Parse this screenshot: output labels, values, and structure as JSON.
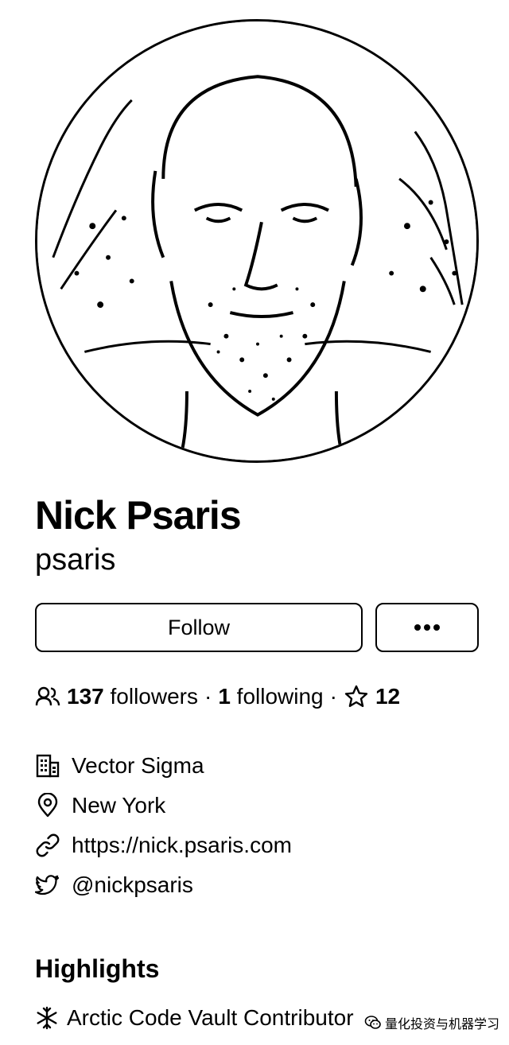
{
  "profile": {
    "name": "Nick Psaris",
    "username": "psaris",
    "follow_label": "Follow",
    "more_icon": "kebab-horizontal-icon"
  },
  "stats": {
    "followers_count": "137",
    "followers_label": "followers",
    "separator": "·",
    "following_count": "1",
    "following_label": "following",
    "stars_count": "12",
    "people_icon": "people-icon",
    "star_icon": "star-icon"
  },
  "details": [
    {
      "icon": "organization-icon",
      "text": "Vector Sigma"
    },
    {
      "icon": "location-icon",
      "text": "New York"
    },
    {
      "icon": "link-icon",
      "text": "https://nick.psaris.com"
    },
    {
      "icon": "twitter-icon",
      "text": "@nickpsaris"
    }
  ],
  "highlights": {
    "title": "Highlights",
    "items": [
      {
        "icon": "snowflake-icon",
        "text": "Arctic Code Vault Contributor"
      }
    ]
  },
  "watermark": {
    "text": "量化投资与机器学习"
  }
}
